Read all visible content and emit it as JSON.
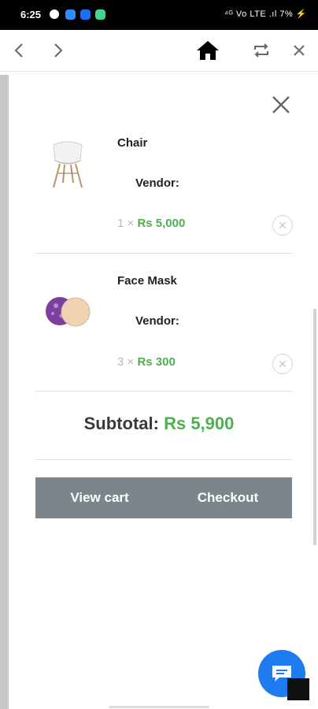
{
  "status_bar": {
    "time": "6:25",
    "right": "⁴ᴳ Vo LTE  .ıl  7% ⚡"
  },
  "toolbar": {
    "back": "back",
    "forward": "forward",
    "home": "home",
    "refresh": "refresh",
    "close": "close"
  },
  "cart": {
    "items": [
      {
        "name": "Chair",
        "vendor_label": "Vendor:",
        "quantity": "1",
        "times": "×",
        "price": "Rs 5,000",
        "image": "chair"
      },
      {
        "name": "Face Mask",
        "vendor_label": "Vendor:",
        "quantity": "3",
        "times": "×",
        "price": "Rs 300",
        "image": "face-mask"
      }
    ],
    "subtotal_label": "Subtotal:",
    "subtotal_value": "Rs 5,900",
    "view_cart_label": "View cart",
    "checkout_label": "Checkout"
  },
  "colors": {
    "accent": "#4caf50",
    "button_bg": "#7a868c",
    "chat": "#1e7bf0"
  }
}
